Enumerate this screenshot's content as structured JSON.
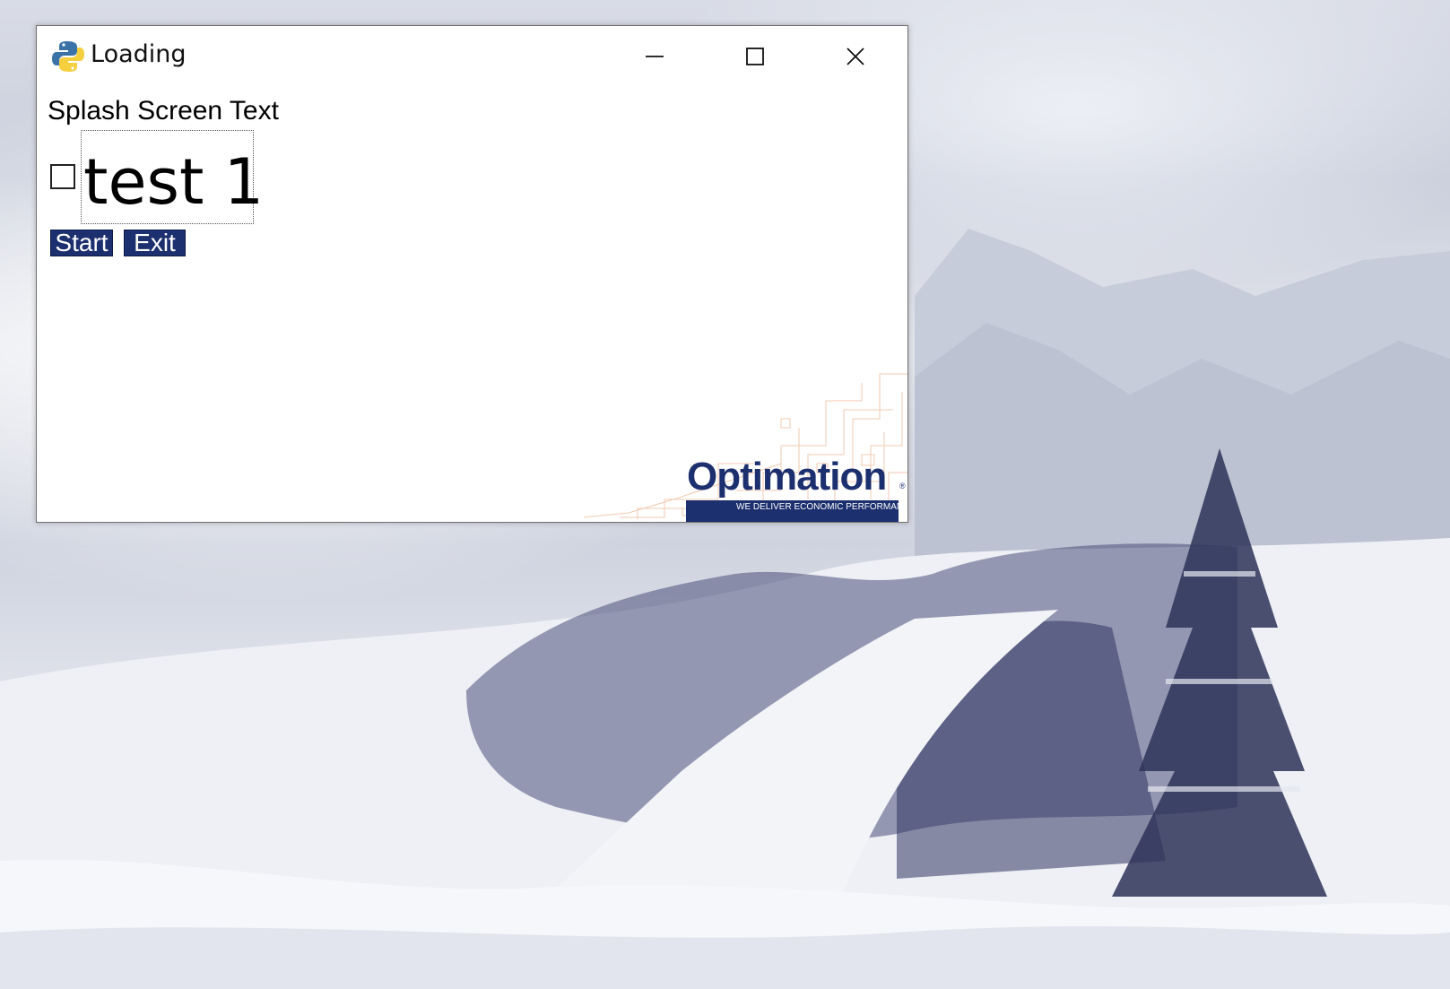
{
  "window": {
    "title": "Loading",
    "icon": "python-icon",
    "controls": {
      "minimize": "minimize-icon",
      "maximize": "maximize-icon",
      "close": "close-icon"
    }
  },
  "content": {
    "splash_text": "Splash Screen Text",
    "checkbox": {
      "label": "test 1",
      "checked": false
    },
    "buttons": {
      "start": "Start",
      "exit": "Exit"
    }
  },
  "branding": {
    "logo_name": "Optimation",
    "tagline": "WE DELIVER ECONOMIC PERFORMANCE",
    "registered_mark": "®"
  },
  "colors": {
    "button_bg": "#1c2f6e",
    "button_text": "#ffffff",
    "logo_blue": "#1c2f6e",
    "logo_accent": "#e8a070"
  }
}
